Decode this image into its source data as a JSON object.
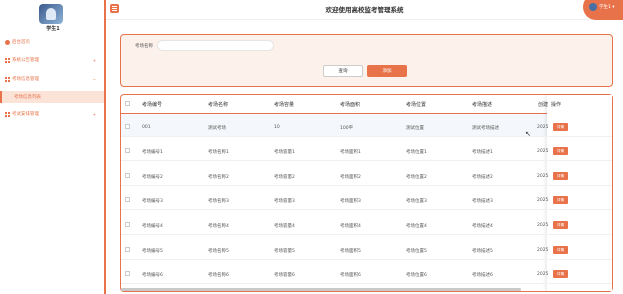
{
  "sidebar": {
    "user_name": "学生1",
    "items": [
      {
        "label": "后台首页",
        "arrow": ""
      },
      {
        "label": "系统公告管理",
        "arrow": "+"
      },
      {
        "label": "考场信息管理",
        "arrow": "−"
      },
      {
        "label": "考试安排管理",
        "arrow": "+"
      }
    ],
    "active_sub": "考场信息列表"
  },
  "header": {
    "title": "欢迎使用高校监考管理系统",
    "user_label": "学生1 ▾"
  },
  "search": {
    "label": "考场名称",
    "placeholder": "",
    "query_label": "查询",
    "add_label": "添加"
  },
  "table": {
    "columns": [
      "考场编号",
      "考场名称",
      "考场容量",
      "考场面积",
      "考场位置",
      "考场描述",
      "创建",
      "操作"
    ],
    "rows": [
      [
        "001",
        "测试考场",
        "10",
        "100平",
        "测试位置",
        "测试考场描述",
        "2025"
      ],
      [
        "考场编号1",
        "考场名称1",
        "考场容量1",
        "考场面积1",
        "考场位置1",
        "考场描述1",
        "2025"
      ],
      [
        "考场编号2",
        "考场名称2",
        "考场容量2",
        "考场面积2",
        "考场位置2",
        "考场描述2",
        "2025"
      ],
      [
        "考场编号3",
        "考场名称3",
        "考场容量3",
        "考场面积3",
        "考场位置3",
        "考场描述3",
        "2025"
      ],
      [
        "考场编号4",
        "考场名称4",
        "考场容量4",
        "考场面积4",
        "考场位置4",
        "考场描述4",
        "2025"
      ],
      [
        "考场编号5",
        "考场名称5",
        "考场容量5",
        "考场面积5",
        "考场位置5",
        "考场描述5",
        "2025"
      ],
      [
        "考场编号6",
        "考场名称6",
        "考场容量6",
        "考场面积6",
        "考场位置6",
        "考场描述6",
        "2025"
      ]
    ],
    "op_label": "详情"
  },
  "colors": {
    "accent": "#e8734a",
    "panel_bg": "#fdf1eb"
  }
}
